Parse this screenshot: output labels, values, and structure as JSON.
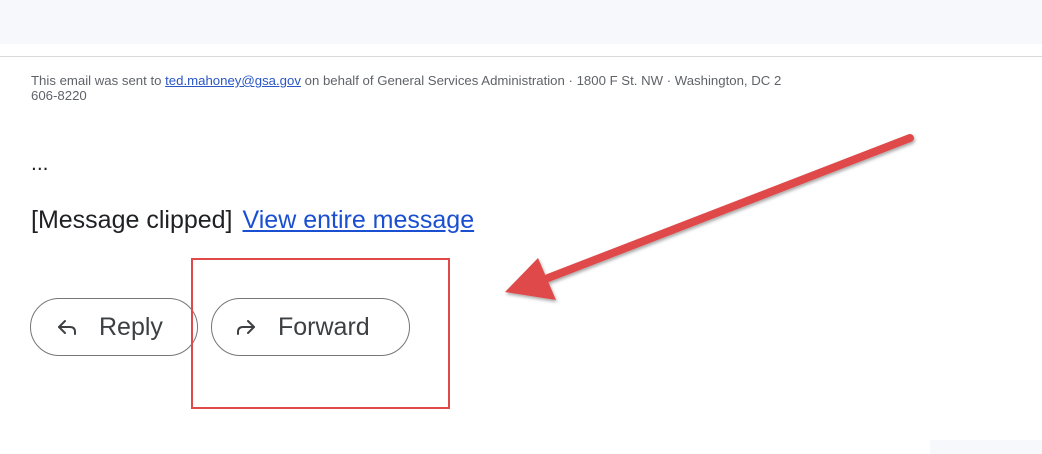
{
  "footer": {
    "prefix": "This email was sent to ",
    "email": "ted.mahoney@gsa.gov",
    "suffix": " on behalf of General Services Administration · 1800 F St. NW · Washington, DC 2",
    "line2": "606-8220"
  },
  "body": {
    "ellipsis": "...",
    "clipped_text": "[Message clipped]",
    "view_link": "View entire message"
  },
  "actions": {
    "reply_label": "Reply",
    "reply_icon": "reply-icon",
    "forward_label": "Forward",
    "forward_icon": "forward-icon"
  },
  "annotation": {
    "box_color": "#e0484a",
    "arrow_color": "#e0484a"
  }
}
